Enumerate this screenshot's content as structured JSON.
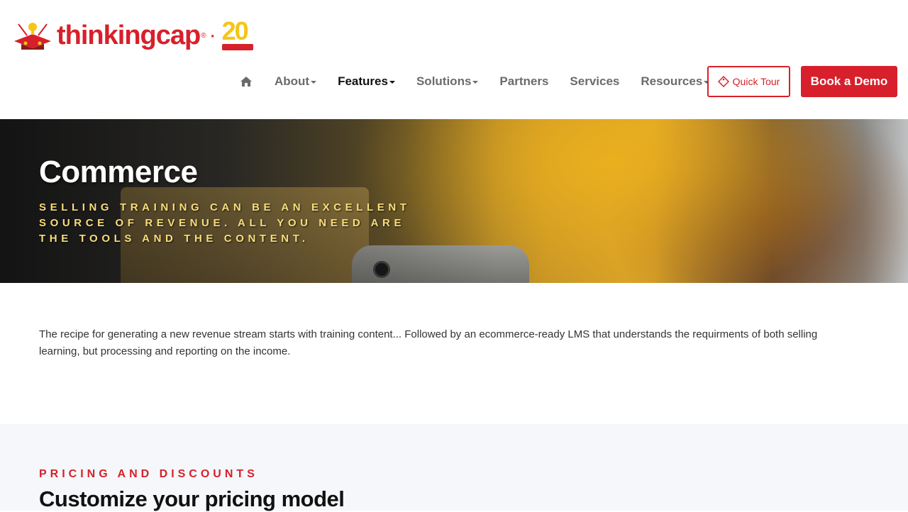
{
  "header": {
    "logo": {
      "brand": "thinkingcap",
      "registered": "®",
      "separator": "·",
      "anniversary": "20"
    },
    "nav": {
      "items": [
        {
          "label": "About",
          "has_dropdown": true
        },
        {
          "label": "Features",
          "has_dropdown": true,
          "active": true
        },
        {
          "label": "Solutions",
          "has_dropdown": true
        },
        {
          "label": "Partners",
          "has_dropdown": false
        },
        {
          "label": "Services",
          "has_dropdown": false
        },
        {
          "label": "Resources",
          "has_dropdown": true
        }
      ],
      "home_icon": "home-icon"
    },
    "quick_tour_label": "Quick Tour",
    "quick_tour_icon": "tag-icon",
    "book_demo_label": "Book a Demo"
  },
  "hero": {
    "title": "Commerce",
    "subtitle": "Selling training can be an excellent source of revenue. All you need are the tools and the content."
  },
  "intro": {
    "text": "The recipe for generating a new revenue stream starts with training content... Followed by an ecommerce-ready LMS that understands the requirments of both selling learning, but processing and reporting on the income."
  },
  "pricing_section": {
    "eyebrow": "Pricing and Discounts",
    "title": "Customize your pricing model"
  },
  "colors": {
    "brand_red": "#d7202b",
    "accent_yellow": "#f8dd7a",
    "section_bg": "#f5f7fa"
  }
}
